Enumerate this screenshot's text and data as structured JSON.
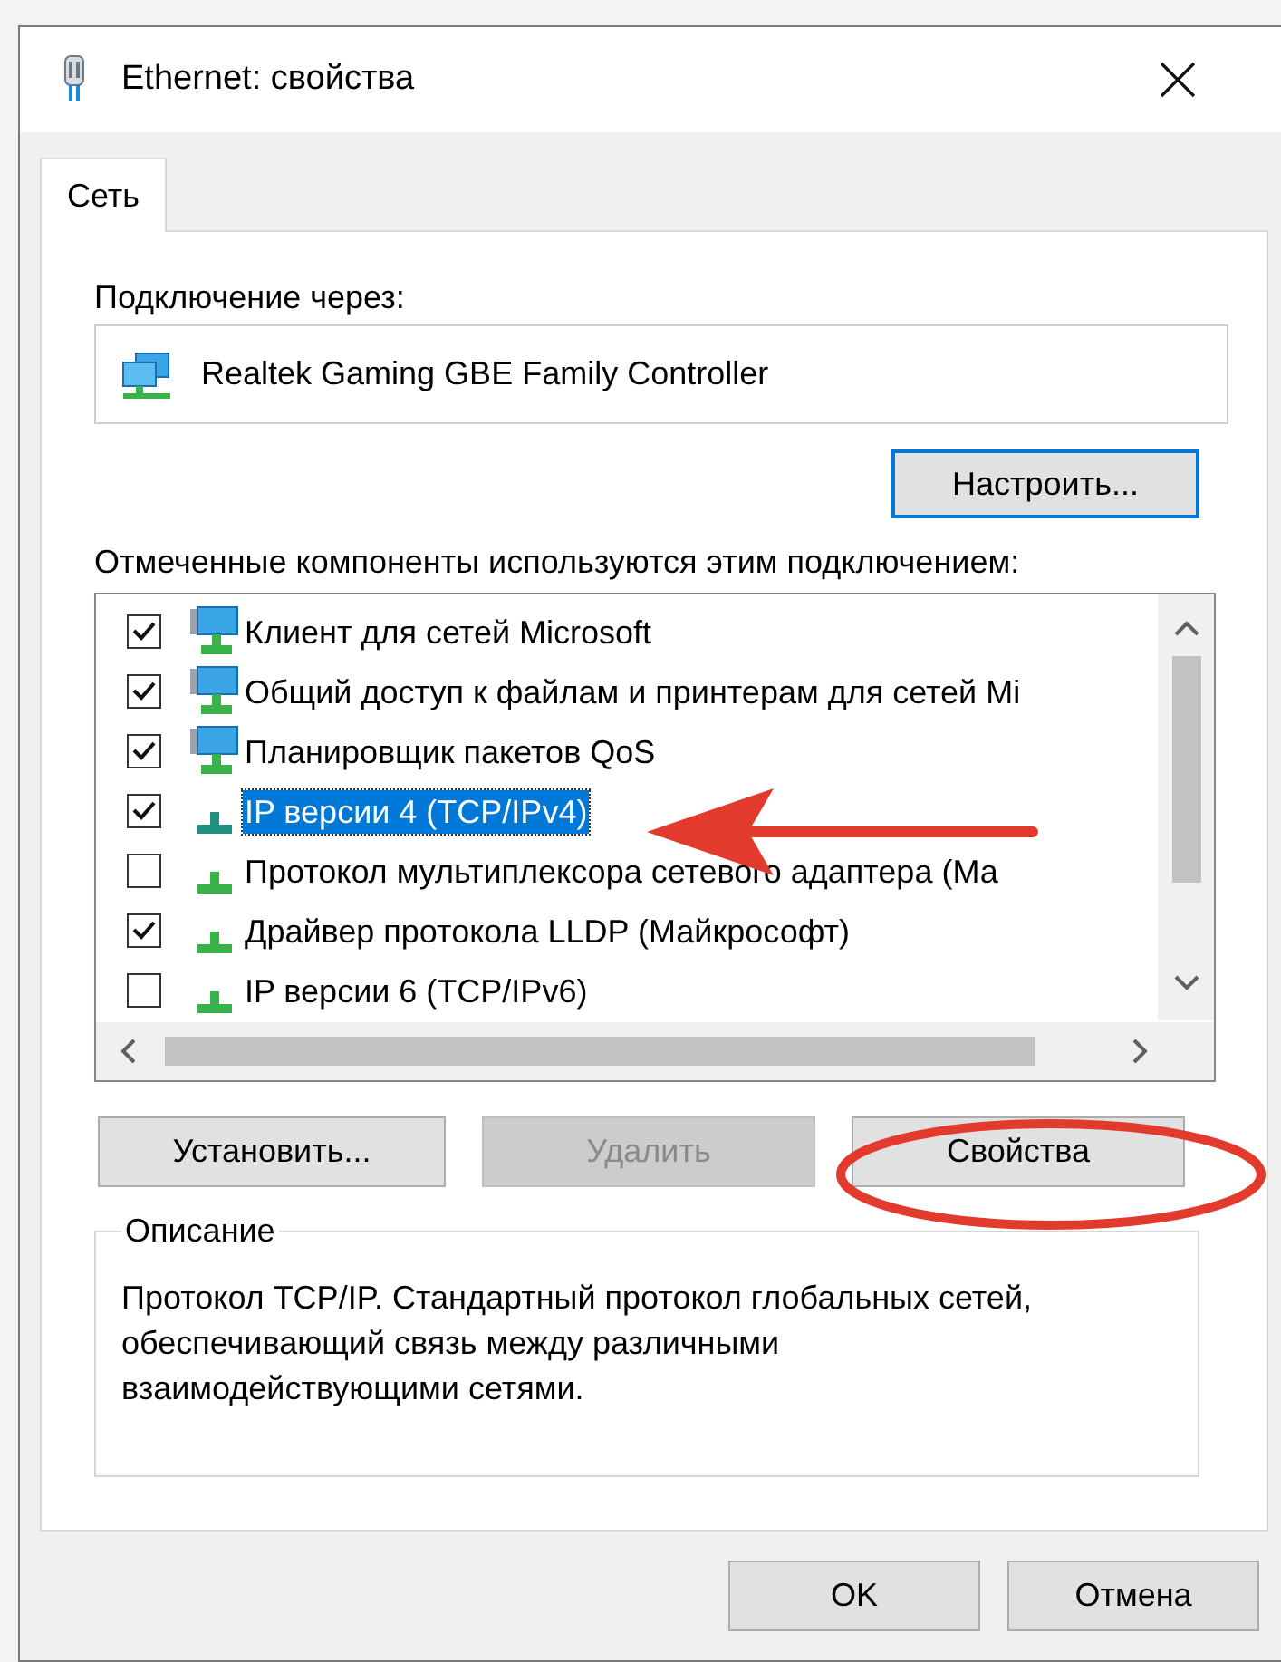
{
  "window": {
    "title": "Ethernet: свойства"
  },
  "tabs": [
    {
      "label": "Сеть",
      "selected": true
    }
  ],
  "connect_using": {
    "label": "Подключение через:",
    "adapter": "Realtek Gaming GBE Family Controller"
  },
  "configure_button": {
    "label": "Настроить...",
    "focused": true
  },
  "components": {
    "label": "Отмеченные компоненты используются этим подключением:",
    "items": [
      {
        "kind": "service",
        "label": "Клиент для сетей Microsoft",
        "checked": true,
        "selected": false
      },
      {
        "kind": "service",
        "label": "Общий доступ к файлам и принтерам для сетей Mi",
        "checked": true,
        "selected": false
      },
      {
        "kind": "service",
        "label": "Планировщик пакетов QoS",
        "checked": true,
        "selected": false
      },
      {
        "kind": "protocol",
        "label": "IP версии 4 (TCP/IPv4)",
        "checked": true,
        "selected": true
      },
      {
        "kind": "protocol",
        "label": "Протокол мультиплексора сетевого адаптера (Ма",
        "checked": false,
        "selected": false
      },
      {
        "kind": "protocol",
        "label": "Драйвер протокола LLDP (Майкрософт)",
        "checked": true,
        "selected": false
      },
      {
        "kind": "protocol",
        "label": "IP версии 6 (TCP/IPv6)",
        "checked": false,
        "selected": false
      }
    ]
  },
  "action_buttons": [
    {
      "label": "Установить...",
      "disabled": false
    },
    {
      "label": "Удалить",
      "disabled": true
    },
    {
      "label": "Свойства",
      "disabled": false
    }
  ],
  "description": {
    "title": "Описание",
    "text": "Протокол TCP/IP. Стандартный протокол глобальных сетей, обеспечивающий связь между различными взаимодействующими сетями."
  },
  "dialog_buttons": [
    {
      "label": "OK"
    },
    {
      "label": "Отмена"
    }
  ]
}
